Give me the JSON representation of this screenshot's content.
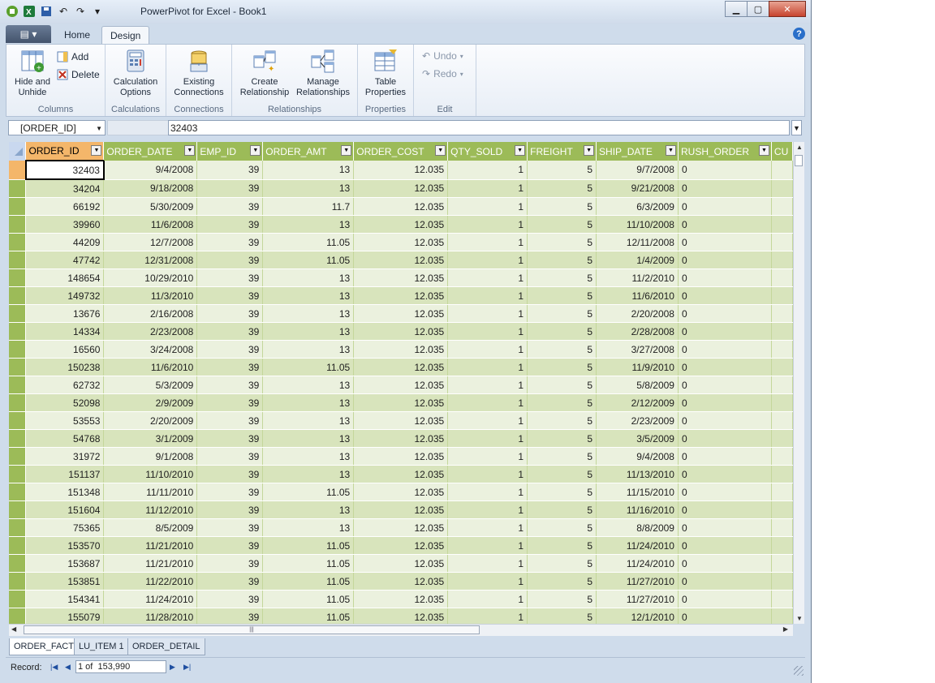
{
  "window": {
    "title": "PowerPivot for Excel - Book1"
  },
  "ribbon": {
    "tabs": [
      "Home",
      "Design"
    ],
    "active_tab": "Design",
    "groups": {
      "columns": {
        "label": "Columns",
        "hide_unhide": "Hide and\nUnhide",
        "add": "Add",
        "delete": "Delete"
      },
      "calculations": {
        "label": "Calculations",
        "calc_options": "Calculation\nOptions"
      },
      "connections": {
        "label": "Connections",
        "existing": "Existing\nConnections"
      },
      "relationships": {
        "label": "Relationships",
        "create": "Create\nRelationship",
        "manage": "Manage\nRelationships"
      },
      "properties": {
        "label": "Properties",
        "table_props": "Table\nProperties"
      },
      "edit": {
        "label": "Edit",
        "undo": "Undo",
        "redo": "Redo"
      }
    }
  },
  "formula_bar": {
    "name_box": "[ORDER_ID]",
    "value": "32403"
  },
  "grid": {
    "columns": [
      "ORDER_ID",
      "ORDER_DATE",
      "EMP_ID",
      "ORDER_AMT",
      "ORDER_COST",
      "QTY_SOLD",
      "FREIGHT",
      "SHIP_DATE",
      "RUSH_ORDER",
      "CU"
    ],
    "rows": [
      [
        "32403",
        "9/4/2008",
        "39",
        "13",
        "12.035",
        "1",
        "5",
        "9/7/2008",
        "0"
      ],
      [
        "34204",
        "9/18/2008",
        "39",
        "13",
        "12.035",
        "1",
        "5",
        "9/21/2008",
        "0"
      ],
      [
        "66192",
        "5/30/2009",
        "39",
        "11.7",
        "12.035",
        "1",
        "5",
        "6/3/2009",
        "0"
      ],
      [
        "39960",
        "11/6/2008",
        "39",
        "13",
        "12.035",
        "1",
        "5",
        "11/10/2008",
        "0"
      ],
      [
        "44209",
        "12/7/2008",
        "39",
        "11.05",
        "12.035",
        "1",
        "5",
        "12/11/2008",
        "0"
      ],
      [
        "47742",
        "12/31/2008",
        "39",
        "11.05",
        "12.035",
        "1",
        "5",
        "1/4/2009",
        "0"
      ],
      [
        "148654",
        "10/29/2010",
        "39",
        "13",
        "12.035",
        "1",
        "5",
        "11/2/2010",
        "0"
      ],
      [
        "149732",
        "11/3/2010",
        "39",
        "13",
        "12.035",
        "1",
        "5",
        "11/6/2010",
        "0"
      ],
      [
        "13676",
        "2/16/2008",
        "39",
        "13",
        "12.035",
        "1",
        "5",
        "2/20/2008",
        "0"
      ],
      [
        "14334",
        "2/23/2008",
        "39",
        "13",
        "12.035",
        "1",
        "5",
        "2/28/2008",
        "0"
      ],
      [
        "16560",
        "3/24/2008",
        "39",
        "13",
        "12.035",
        "1",
        "5",
        "3/27/2008",
        "0"
      ],
      [
        "150238",
        "11/6/2010",
        "39",
        "11.05",
        "12.035",
        "1",
        "5",
        "11/9/2010",
        "0"
      ],
      [
        "62732",
        "5/3/2009",
        "39",
        "13",
        "12.035",
        "1",
        "5",
        "5/8/2009",
        "0"
      ],
      [
        "52098",
        "2/9/2009",
        "39",
        "13",
        "12.035",
        "1",
        "5",
        "2/12/2009",
        "0"
      ],
      [
        "53553",
        "2/20/2009",
        "39",
        "13",
        "12.035",
        "1",
        "5",
        "2/23/2009",
        "0"
      ],
      [
        "54768",
        "3/1/2009",
        "39",
        "13",
        "12.035",
        "1",
        "5",
        "3/5/2009",
        "0"
      ],
      [
        "31972",
        "9/1/2008",
        "39",
        "13",
        "12.035",
        "1",
        "5",
        "9/4/2008",
        "0"
      ],
      [
        "151137",
        "11/10/2010",
        "39",
        "13",
        "12.035",
        "1",
        "5",
        "11/13/2010",
        "0"
      ],
      [
        "151348",
        "11/11/2010",
        "39",
        "11.05",
        "12.035",
        "1",
        "5",
        "11/15/2010",
        "0"
      ],
      [
        "151604",
        "11/12/2010",
        "39",
        "13",
        "12.035",
        "1",
        "5",
        "11/16/2010",
        "0"
      ],
      [
        "75365",
        "8/5/2009",
        "39",
        "13",
        "12.035",
        "1",
        "5",
        "8/8/2009",
        "0"
      ],
      [
        "153570",
        "11/21/2010",
        "39",
        "11.05",
        "12.035",
        "1",
        "5",
        "11/24/2010",
        "0"
      ],
      [
        "153687",
        "11/21/2010",
        "39",
        "11.05",
        "12.035",
        "1",
        "5",
        "11/24/2010",
        "0"
      ],
      [
        "153851",
        "11/22/2010",
        "39",
        "11.05",
        "12.035",
        "1",
        "5",
        "11/27/2010",
        "0"
      ],
      [
        "154341",
        "11/24/2010",
        "39",
        "11.05",
        "12.035",
        "1",
        "5",
        "11/27/2010",
        "0"
      ],
      [
        "155079",
        "11/28/2010",
        "39",
        "11.05",
        "12.035",
        "1",
        "5",
        "12/1/2010",
        "0"
      ]
    ]
  },
  "sheets": [
    "ORDER_FACT",
    "LU_ITEM 1",
    "ORDER_DETAIL"
  ],
  "active_sheet": "ORDER_FACT",
  "status": {
    "record_label": "Record:",
    "record_value": "1 of  153,990"
  },
  "colors": {
    "header_green": "#9cbb58",
    "row_light": "#ebf1de",
    "row_dark": "#d8e4bc",
    "selected_orange": "#f4b66a"
  }
}
